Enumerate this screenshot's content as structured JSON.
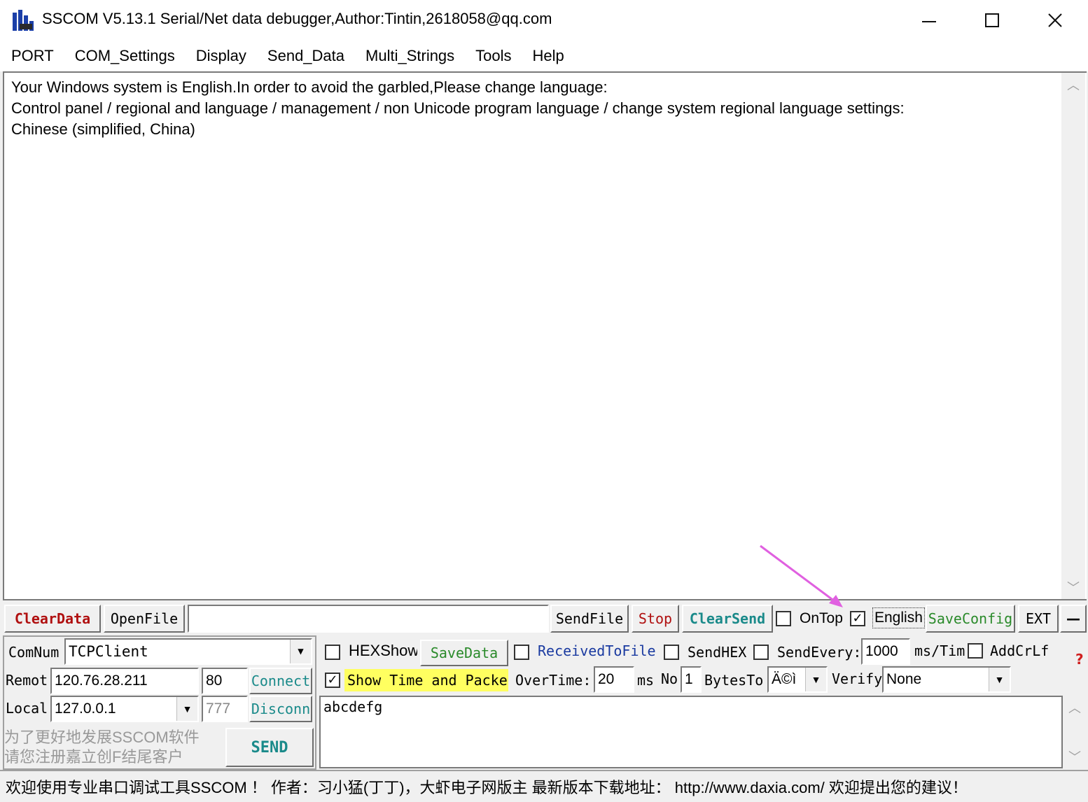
{
  "window": {
    "title": "SSCOM V5.13.1 Serial/Net data debugger,Author:Tintin,2618058@qq.com"
  },
  "menu": [
    "PORT",
    "COM_Settings",
    "Display",
    "Send_Data",
    "Multi_Strings",
    "Tools",
    "Help"
  ],
  "receive": {
    "lines": [
      "Your Windows system is English.In order to avoid the garbled,Please change language:",
      "Control panel / regional and language / management / non Unicode program language / change system regional language settings:",
      "Chinese (simplified, China)"
    ]
  },
  "toolbar": {
    "clear_data": "ClearData",
    "open_file": "OpenFile",
    "file_path": "",
    "send_file": "SendFile",
    "stop": "Stop",
    "clear_send": "ClearSend",
    "on_top": "OnTop",
    "on_top_checked": false,
    "english": "English",
    "english_checked": true,
    "save_config": "SaveConfig",
    "ext": "EXT",
    "minus": "—"
  },
  "connection": {
    "comnum_label": "ComNum",
    "comnum_value": "TCPClient",
    "remote_label": "Remot",
    "remote_ip": "120.76.28.211",
    "remote_port": "80",
    "connect": "Connect",
    "local_label": "Local",
    "local_ip": "127.0.0.1",
    "local_port": "777",
    "disconnect": "Disconn",
    "promo_line1": "为了更好地发展SSCOM软件",
    "promo_line2": "请您注册嘉立创F结尾客户",
    "send": "SEND"
  },
  "options": {
    "hex_show": "HEXShow",
    "save_data": "SaveData",
    "received_to_file": "ReceivedToFile",
    "send_hex": "SendHEX",
    "send_every": "SendEvery:",
    "interval": "1000",
    "ms_tim": "ms/Tim",
    "add_crlf": "AddCrLf",
    "help_mark": "?",
    "show_time": "Show Time and Packe",
    "show_time_checked": true,
    "overtime_label": "OverTime:",
    "overtime_value": "20",
    "ms": "ms",
    "no_label": "No",
    "no_value": "1",
    "bytes_to": "BytesTo",
    "bytes_to_value": "Ä©ì",
    "verify_label": "Verify",
    "verify_value": "None"
  },
  "send_text": "abcdefg",
  "status": {
    "text": "欢迎使用专业串口调试工具SSCOM ！  作者：习小猛(丁丁)，大虾电子网版主  最新版本下载地址： http://www.daxia.com/ 欢迎提出您的建议！"
  },
  "colors": {
    "clear_data": "#b01010",
    "stop": "#b01010",
    "teal": "#1a8a8a",
    "blue_link": "#1a3aa0",
    "green_btn": "#2a8a2a",
    "highlight_yellow": "#ffff60",
    "annotation_arrow": "#e060e0"
  }
}
